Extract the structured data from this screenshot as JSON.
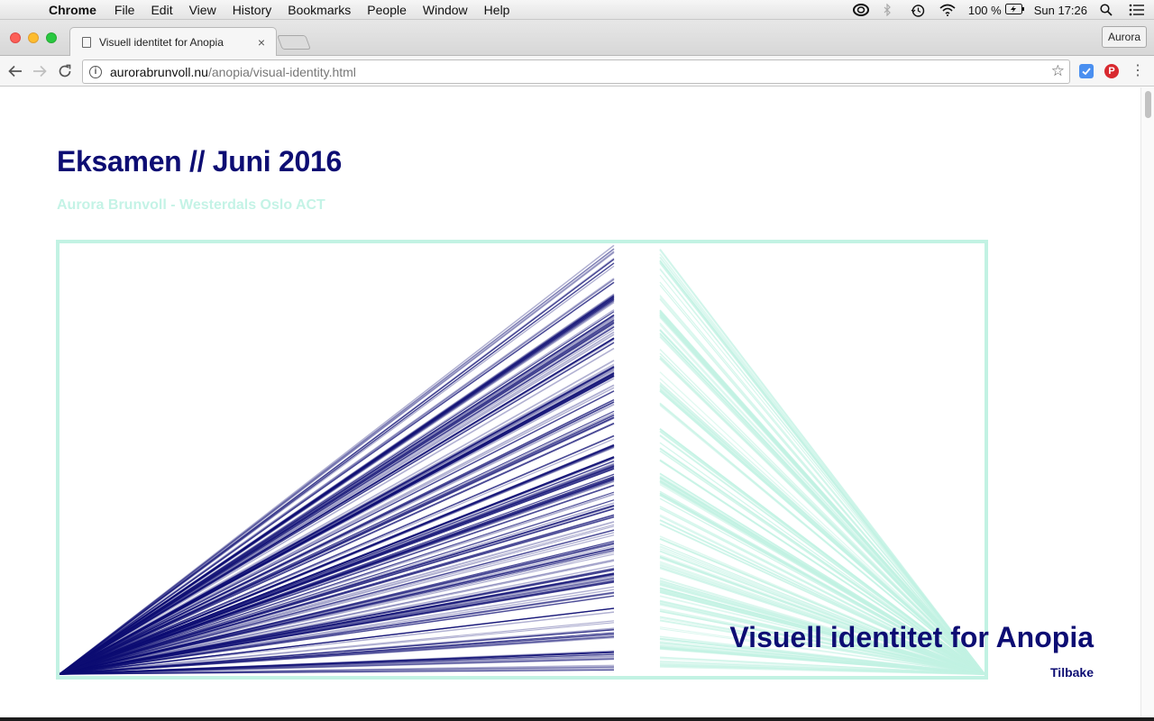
{
  "menubar": {
    "app_name": "Chrome",
    "items": [
      "File",
      "Edit",
      "View",
      "History",
      "Bookmarks",
      "People",
      "Window",
      "Help"
    ],
    "battery": "100 %",
    "clock": "Sun 17:26"
  },
  "browser": {
    "tab_title": "Visuell identitet for Anopia",
    "tab_close": "×",
    "profile": "Aurora",
    "url_host": "aurorabrunvoll.nu",
    "url_path": "/anopia/visual-identity.html"
  },
  "page": {
    "title": "Eksamen // Juni 2016",
    "subtitle": "Aurora Brunvoll - Westerdals Oslo ACT",
    "project_title": "Visuell identitet for Anopia",
    "back_link": "Tilbake"
  },
  "colors": {
    "navy": "#0d0d73",
    "mint": "#c2f2e3",
    "mint_light": "#c4f3e6"
  }
}
